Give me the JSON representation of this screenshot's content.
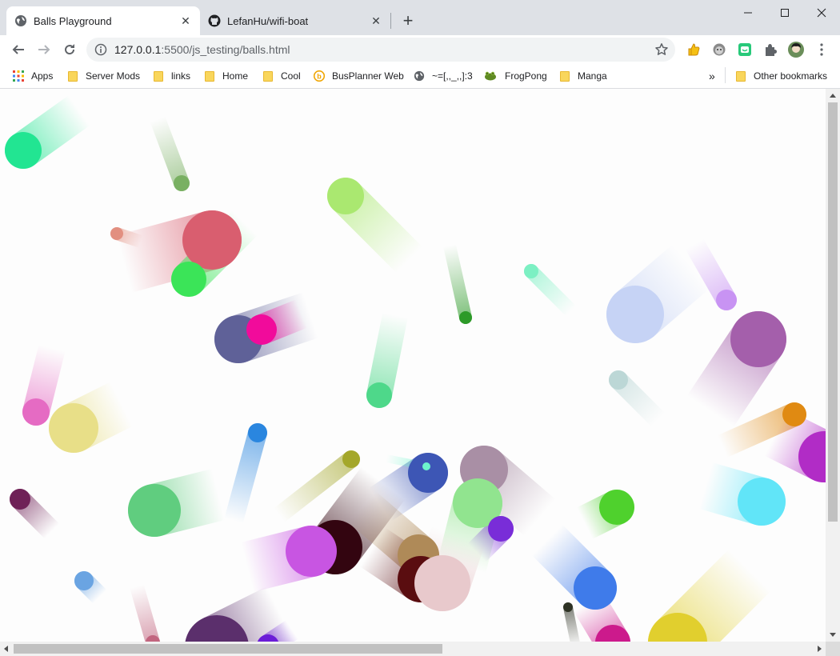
{
  "tabs": [
    {
      "title": "Balls Playground",
      "icon": "globe-icon",
      "active": true
    },
    {
      "title": "LefanHu/wifi-boat",
      "icon": "github-icon",
      "active": false
    }
  ],
  "omnibox": {
    "url_host": "127.0.0.1",
    "url_rest": ":5500/js_testing/balls.html"
  },
  "bookmarks": [
    {
      "label": "Apps",
      "icon": "apps-grid-icon"
    },
    {
      "label": "Server Mods",
      "icon": "folder-icon"
    },
    {
      "label": "links",
      "icon": "folder-icon"
    },
    {
      "label": "Home",
      "icon": "folder-icon"
    },
    {
      "label": "Cool",
      "icon": "folder-icon"
    },
    {
      "label": "BusPlanner Web",
      "icon": "busplanner-icon"
    },
    {
      "label": "~=[,,_,,]:3",
      "icon": "globe-icon"
    },
    {
      "label": "FrogPong",
      "icon": "frog-icon"
    },
    {
      "label": "Manga",
      "icon": "folder-icon"
    }
  ],
  "other_bookmarks": "Other bookmarks",
  "colors": {
    "tabstrip": "#dee1e6",
    "omnibox": "#f1f3f4",
    "folder": "#f9d65c"
  },
  "balls": [
    {
      "color": "#22e592"
    },
    {
      "color": "#79b062"
    },
    {
      "color": "#d95e6f"
    },
    {
      "color": "#e28f80"
    },
    {
      "color": "#3be458"
    },
    {
      "color": "#aae870"
    },
    {
      "color": "#5f6198"
    },
    {
      "color": "#f10b9b"
    },
    {
      "color": "#7cf0c3"
    },
    {
      "color": "#2d9a28"
    },
    {
      "color": "#c6d3f5"
    },
    {
      "color": "#c893f3"
    },
    {
      "color": "#a45fab"
    },
    {
      "color": "#4ed88a"
    },
    {
      "color": "#bcd7d6"
    },
    {
      "color": "#e56bc3"
    },
    {
      "color": "#e8df88"
    },
    {
      "color": "#e08a12"
    },
    {
      "color": "#b12cc6"
    },
    {
      "color": "#2a86df"
    },
    {
      "color": "#a4a72a"
    },
    {
      "color": "#3d56b5"
    },
    {
      "color": "#6df5cc"
    },
    {
      "color": "#a98fa5"
    },
    {
      "color": "#91e48f"
    },
    {
      "color": "#792dd8"
    },
    {
      "color": "#61e5f8"
    },
    {
      "color": "#4fd12d"
    },
    {
      "color": "#6f2157"
    },
    {
      "color": "#60cd7f"
    },
    {
      "color": "#330510"
    },
    {
      "color": "#c855e2"
    },
    {
      "color": "#af8a58"
    },
    {
      "color": "#5a0d10"
    },
    {
      "color": "#e8c9cc"
    },
    {
      "color": "#6aa4e2"
    },
    {
      "color": "#3f7bea"
    },
    {
      "color": "#2e3224"
    },
    {
      "color": "#cc1a8c"
    },
    {
      "color": "#e1cf2e"
    },
    {
      "color": "#5b2f6c"
    },
    {
      "color": "#6b1dd7"
    },
    {
      "color": "#c2657f"
    }
  ]
}
